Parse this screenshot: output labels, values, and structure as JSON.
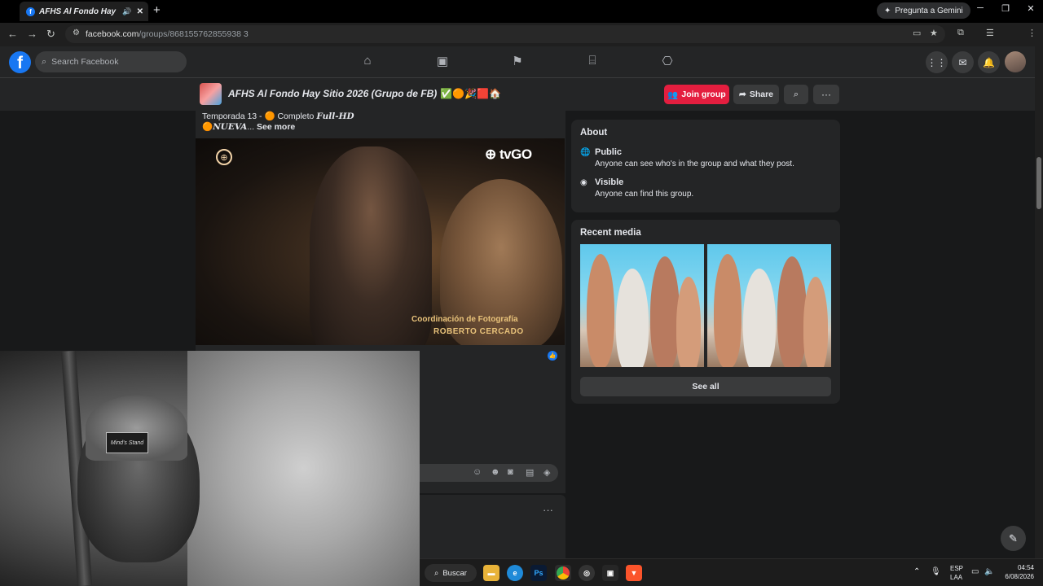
{
  "browser": {
    "tab_title": "AFHS Al Fondo Hay Sitio",
    "audio_icon": "speaker-icon",
    "gemini_label": "Pregunta a Gemini",
    "url_domain": "facebook.com",
    "url_path": "/groups/868155762855938 3"
  },
  "fb": {
    "search_placeholder": "Search Facebook",
    "group_name": "AFHS Al Fondo Hay Sitio 2026 (Grupo de FB)",
    "group_emoji": "✅🟠🎉🟥🏠",
    "join_label": "Join group",
    "share_label": "Share"
  },
  "post": {
    "line1_prefix": "Temporada 13 - ",
    "line1_dot": "🟠",
    "line1_mid": " Completo ",
    "line1_bold": "Full-HD",
    "line2_dot": "🟠",
    "line2_bold": "NUEVA",
    "line2_ellipsis": "... ",
    "see_more": "See more",
    "video_logo": "tvGO",
    "credit_role": "Coordinación de Fotografía",
    "credit_name": "ROBERTO CERCADO",
    "webcam_cap_text": "Mind's Stand"
  },
  "about": {
    "title": "About",
    "public_heading": "Public",
    "public_desc": "Anyone can see who's in the group and what they post.",
    "visible_heading": "Visible",
    "visible_desc": "Anyone can find this group."
  },
  "media": {
    "title": "Recent media",
    "see_all": "See all"
  },
  "taskbar": {
    "search_label": "Buscar",
    "lang_top": "ESP",
    "lang_bottom": "LAA",
    "time": "04:54",
    "date": "6/08/2026"
  },
  "colors": {
    "fb_blue": "#1877f2",
    "join_red": "#e41e3f",
    "dark_bg": "#18191a",
    "card_bg": "#242526"
  }
}
